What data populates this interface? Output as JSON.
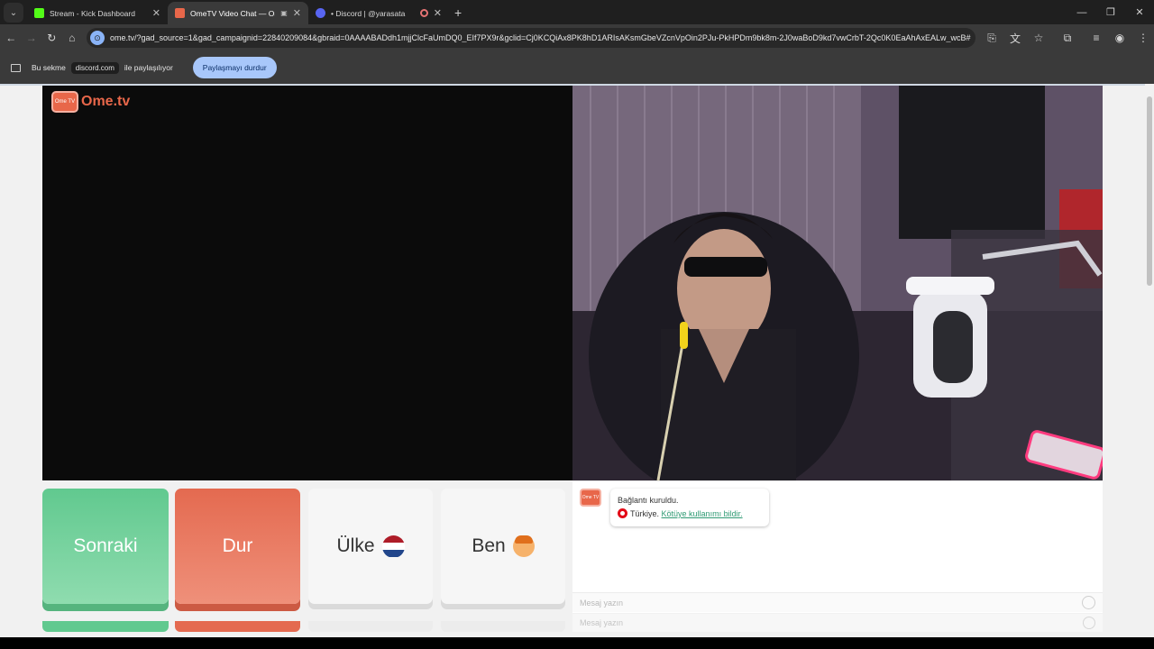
{
  "tabs": [
    {
      "title": "Stream - Kick Dashboard",
      "color": "#53fc18",
      "active": false
    },
    {
      "title": "OmeTV Video Chat — Ome",
      "color": "#e8674a",
      "active": true
    },
    {
      "title": "• Discord | @yarasata",
      "color": "#5865f2",
      "active": false
    }
  ],
  "toolbar": {
    "url": "ome.tv/?gad_source=1&gad_campaignid=22840209084&gbraid=0AAAABADdh1mjjClcFaUmDQ0_EIf7PX9r&gclid=Cj0KCQiAx8PK8hD1ARIsAKsmGbeVZcnVpOin2PJu-PkHPDm9bk8m-2J0waBoD9kd7vwCrbT-2Qc0K0EaAhAxEALw_wcB#"
  },
  "sharebar": {
    "prefix": "Bu sekme",
    "domain": "discord.com",
    "suffix": "ile paylaşılıyor",
    "stop_button": "Paylaşmayı durdur"
  },
  "logo": {
    "badge": "Ome TV",
    "text": "Ome.tv"
  },
  "buttons": {
    "next": "Sonraki",
    "stop": "Dur",
    "country": "Ülke",
    "me": "Ben"
  },
  "chat": {
    "avatar_label": "Ome TV",
    "connected": "Bağlantı kuruldu.",
    "country": "Türkiye.",
    "report_link": "Kötüye kullanımı bildir.",
    "input_placeholder": "Mesaj yazın"
  },
  "icons": {
    "back": "arrow-left-icon",
    "forward": "arrow-right-icon",
    "reload": "reload-icon",
    "home": "home-icon"
  }
}
